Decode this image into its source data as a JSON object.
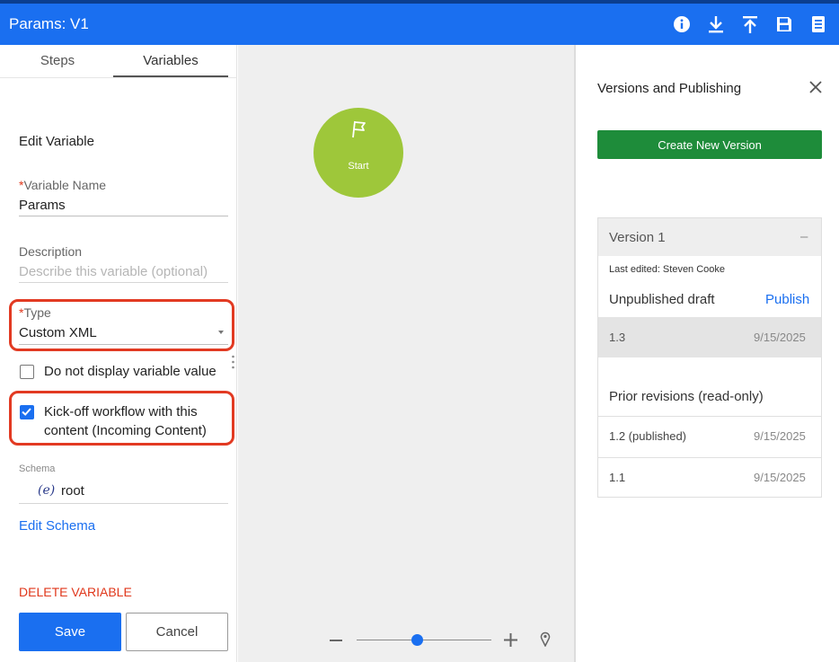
{
  "header": {
    "title": "Params: V1",
    "tools": [
      "info-icon",
      "download-icon",
      "upload-icon",
      "save-icon",
      "notes-icon"
    ]
  },
  "left_panel": {
    "tabs": [
      {
        "label": "Steps",
        "active": false
      },
      {
        "label": "Variables",
        "active": true
      }
    ],
    "section_title": "Edit Variable",
    "variable_name": {
      "required_mark": "*",
      "label": "Variable Name",
      "value": "Params"
    },
    "description": {
      "label": "Description",
      "placeholder": "Describe this variable (optional)"
    },
    "type": {
      "required_mark": "*",
      "label": "Type",
      "value": "Custom XML"
    },
    "checkbox_hide": {
      "label": "Do not display variable value",
      "checked": false
    },
    "checkbox_kickoff": {
      "label_line1": "Kick-off workflow with this",
      "label_line2": "content (Incoming Content)",
      "checked": true
    },
    "schema": {
      "label": "Schema",
      "badge": "(e)",
      "value": "root"
    },
    "edit_schema": "Edit Schema",
    "delete": "DELETE VARIABLE",
    "save": "Save",
    "cancel": "Cancel"
  },
  "canvas": {
    "start_label": "Start",
    "zoom_level": 0.45
  },
  "versions_panel": {
    "title": "Versions and Publishing",
    "create_button": "Create New Version",
    "version_header": "Version 1",
    "collapse_symbol": "–",
    "last_edited": "Last edited: Steven Cooke",
    "status": "Unpublished draft",
    "publish": "Publish",
    "current_revision": {
      "id": "1.3",
      "date": "9/15/2025"
    },
    "prior_title": "Prior revisions (read-only)",
    "prior_revisions": [
      {
        "id": "1.2 (published)",
        "date": "9/15/2025"
      },
      {
        "id": "1.1",
        "date": "9/15/2025"
      }
    ]
  },
  "colors": {
    "brand_blue": "#1a6ff0",
    "green_button": "#1e8c3a",
    "start_node": "#9ec73a",
    "danger": "#e0371b",
    "highlight": "#e23a22"
  }
}
